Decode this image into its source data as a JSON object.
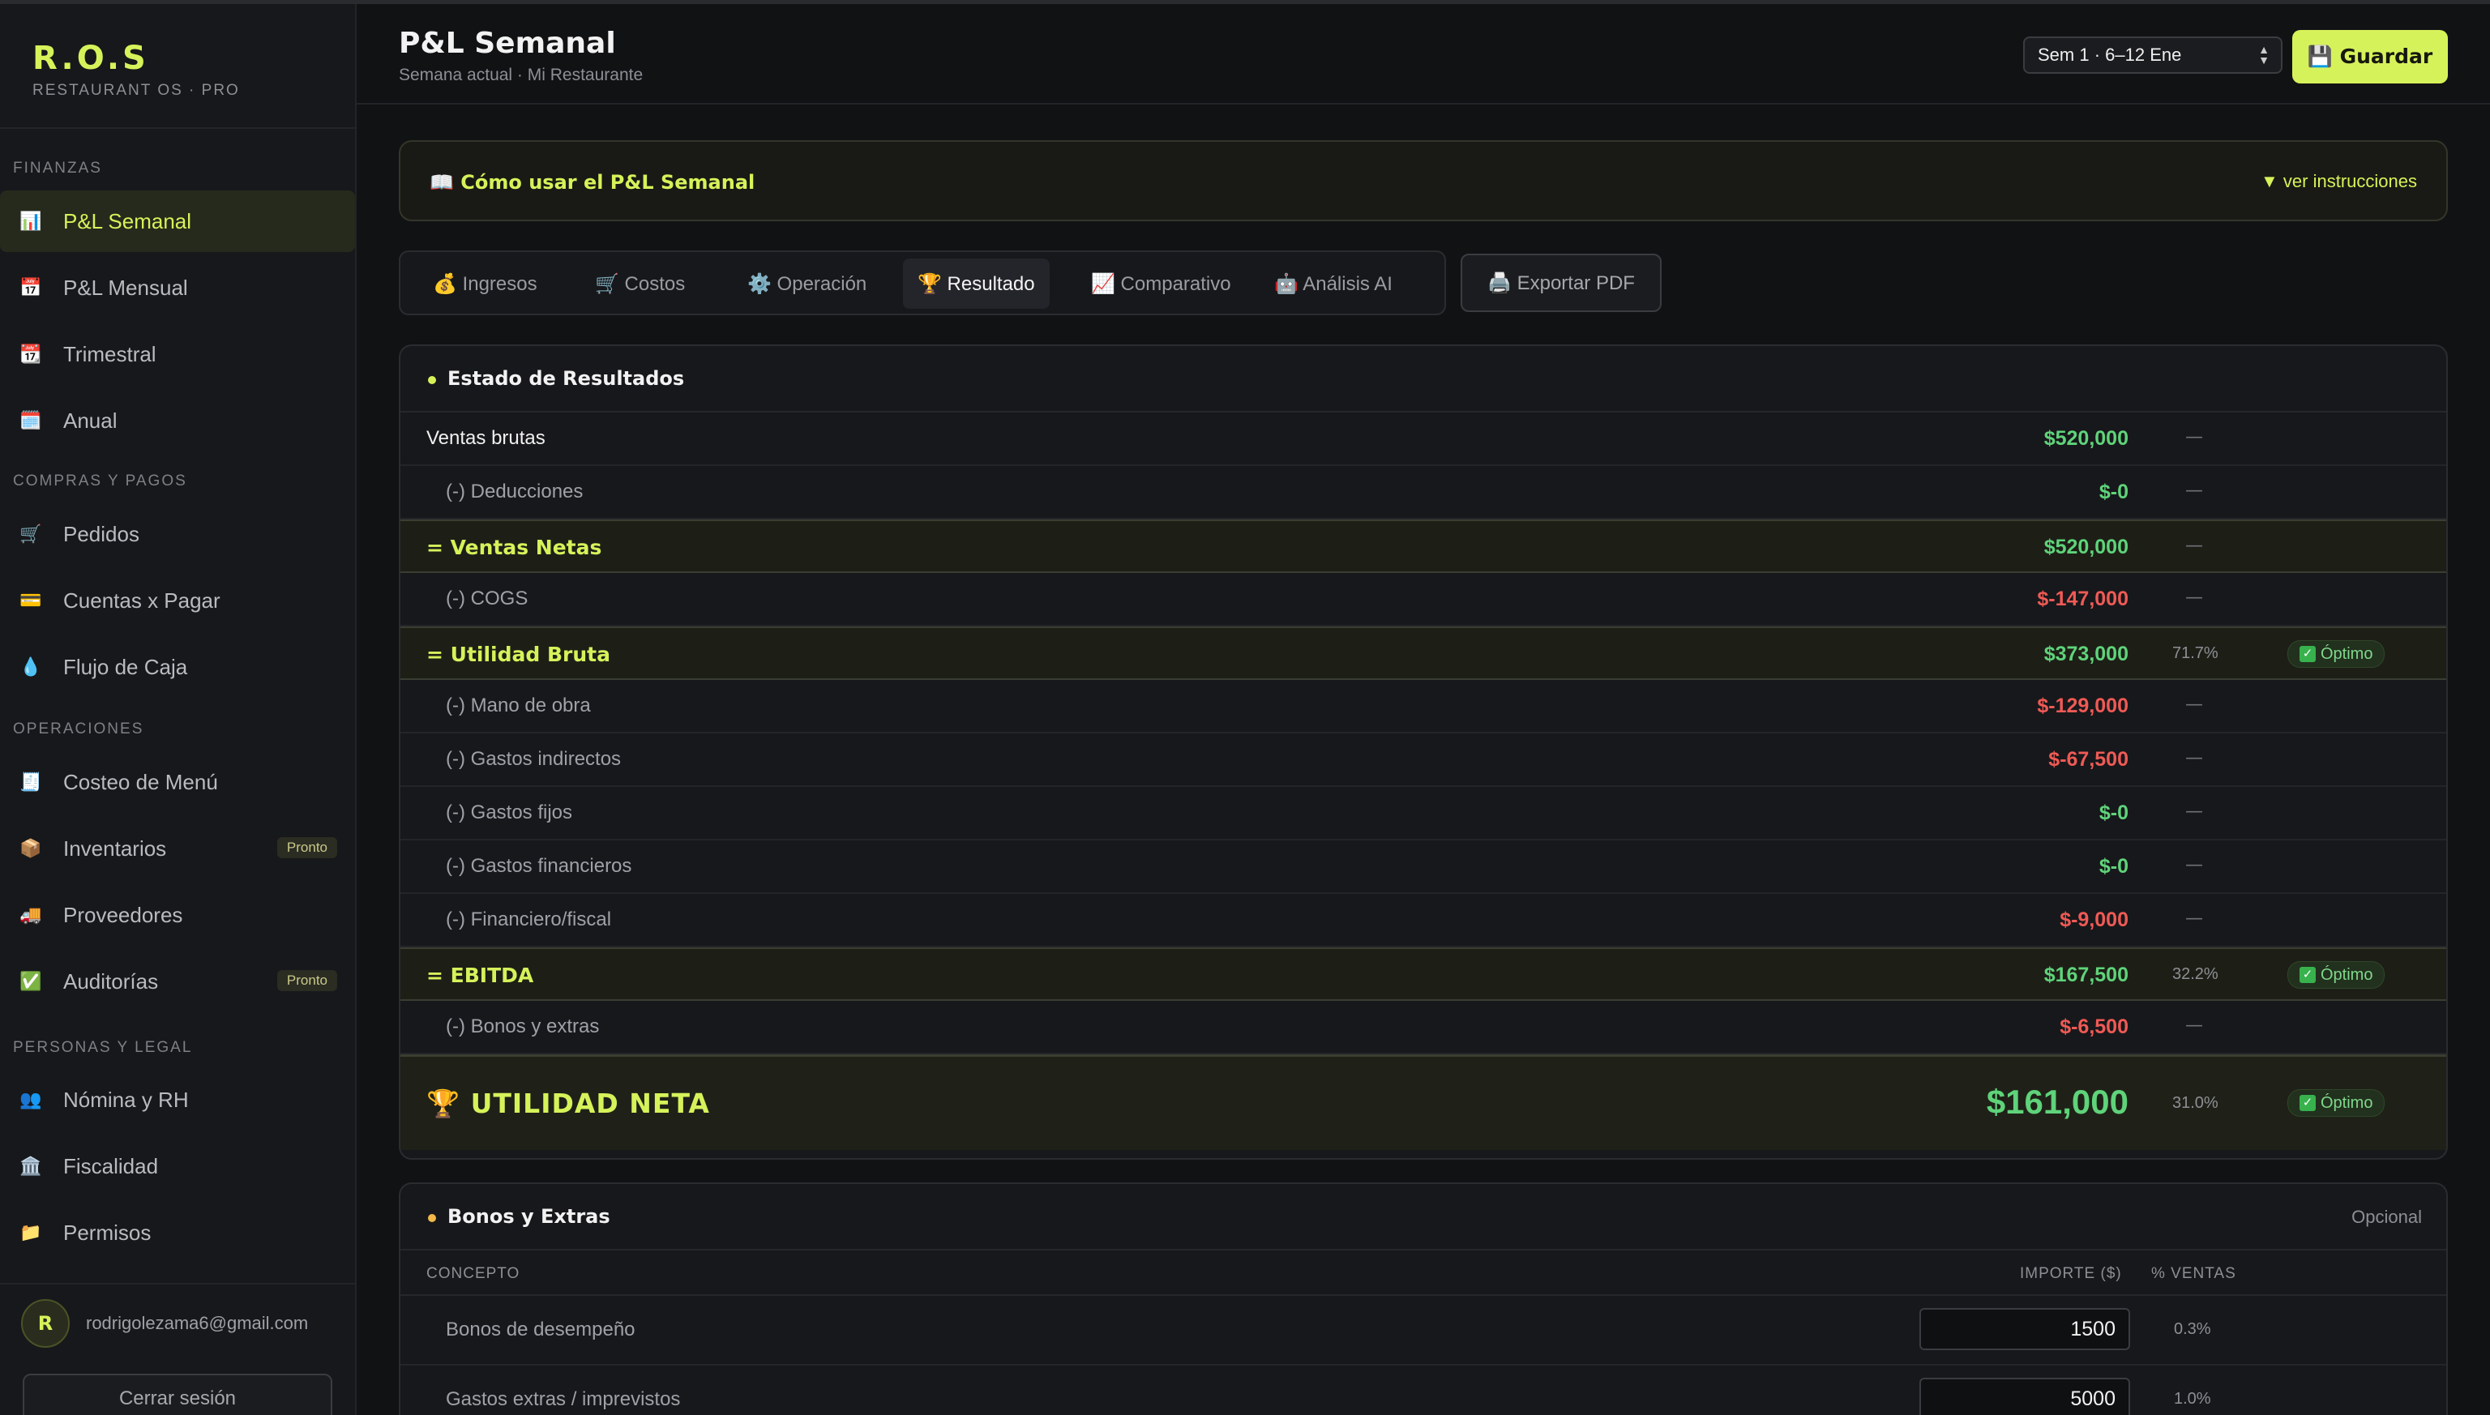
{
  "brand": {
    "logo": "R.O.S",
    "subtitle": "RESTAURANT OS · PRO"
  },
  "sidebar": {
    "sections": [
      {
        "title": "FINANZAS",
        "items": [
          {
            "label": "P&L Semanal",
            "icon": "📊",
            "active": true
          },
          {
            "label": "P&L Mensual",
            "icon": "📅"
          },
          {
            "label": "Trimestral",
            "icon": "📆"
          },
          {
            "label": "Anual",
            "icon": "🗓️"
          }
        ]
      },
      {
        "title": "COMPRAS Y PAGOS",
        "items": [
          {
            "label": "Pedidos",
            "icon": "🛒"
          },
          {
            "label": "Cuentas x Pagar",
            "icon": "💳"
          },
          {
            "label": "Flujo de Caja",
            "icon": "💧"
          }
        ]
      },
      {
        "title": "OPERACIONES",
        "items": [
          {
            "label": "Costeo de Menú",
            "icon": "🧾"
          },
          {
            "label": "Inventarios",
            "icon": "📦",
            "badge": "Pronto"
          },
          {
            "label": "Proveedores",
            "icon": "🚚"
          },
          {
            "label": "Auditorías",
            "icon": "✅",
            "badge": "Pronto"
          }
        ]
      },
      {
        "title": "PERSONAS Y LEGAL",
        "items": [
          {
            "label": "Nómina y RH",
            "icon": "👥"
          },
          {
            "label": "Fiscalidad",
            "icon": "🏛️"
          },
          {
            "label": "Permisos",
            "icon": "📁"
          }
        ]
      }
    ],
    "user": {
      "initial": "R",
      "email": "rodrigolezama6@gmail.com"
    },
    "logout_label": "Cerrar sesión"
  },
  "header": {
    "title": "P&L Semanal",
    "subtitle": "Semana actual · Mi Restaurante",
    "week_selected": "Sem 1 · 6–12 Ene",
    "save_label": "💾 Guardar"
  },
  "help": {
    "title": "📖 Cómo usar el P&L Semanal",
    "toggle": "▼ ver instrucciones"
  },
  "tabs": [
    {
      "label": "💰 Ingresos"
    },
    {
      "label": "🛒 Costos"
    },
    {
      "label": "⚙️ Operación"
    },
    {
      "label": "🏆 Resultado",
      "active": true
    },
    {
      "label": "📈 Comparativo"
    },
    {
      "label": "🤖 Análisis AI"
    }
  ],
  "export_label": "🖨️ Exportar PDF",
  "results": {
    "title": "Estado de Resultados",
    "dot_color": "#d6f25a",
    "rows": [
      {
        "label": "Ventas brutas",
        "amount": "$520,000",
        "sign": "pos",
        "pct": "—",
        "type": "main"
      },
      {
        "label": "(-) Deducciones",
        "amount": "$-0",
        "sign": "pos",
        "pct": "—",
        "type": "sub"
      },
      {
        "label": "= Ventas Netas",
        "amount": "$520,000",
        "sign": "pos",
        "pct": "—",
        "type": "total"
      },
      {
        "label": "(-) COGS",
        "amount": "$-147,000",
        "sign": "neg",
        "pct": "—",
        "type": "sub"
      },
      {
        "label": "= Utilidad Bruta",
        "amount": "$373,000",
        "sign": "pos",
        "pct": "71.7%",
        "type": "total",
        "status": "Óptimo"
      },
      {
        "label": "(-) Mano de obra",
        "amount": "$-129,000",
        "sign": "neg",
        "pct": "—",
        "type": "sub"
      },
      {
        "label": "(-) Gastos indirectos",
        "amount": "$-67,500",
        "sign": "neg",
        "pct": "—",
        "type": "sub"
      },
      {
        "label": "(-) Gastos fijos",
        "amount": "$-0",
        "sign": "pos",
        "pct": "—",
        "type": "sub"
      },
      {
        "label": "(-) Gastos financieros",
        "amount": "$-0",
        "sign": "pos",
        "pct": "—",
        "type": "sub"
      },
      {
        "label": "(-) Financiero/fiscal",
        "amount": "$-9,000",
        "sign": "neg",
        "pct": "—",
        "type": "sub"
      },
      {
        "label": "= EBITDA",
        "amount": "$167,500",
        "sign": "pos",
        "pct": "32.2%",
        "type": "total",
        "status": "Óptimo"
      },
      {
        "label": "(-) Bonos y extras",
        "amount": "$-6,500",
        "sign": "neg",
        "pct": "—",
        "type": "sub"
      }
    ],
    "net": {
      "label": "🏆 UTILIDAD NETA",
      "amount": "$161,000",
      "pct": "31.0%",
      "status": "Óptimo"
    }
  },
  "bonus": {
    "title": "Bonos y Extras",
    "dot_color": "#f0b94a",
    "optional_label": "Opcional",
    "columns": {
      "concept": "CONCEPTO",
      "amount": "IMPORTE ($)",
      "pct": "% VENTAS"
    },
    "rows": [
      {
        "label": "Bonos de desempeño",
        "value": "1500",
        "pct": "0.3%"
      },
      {
        "label": "Gastos extras / imprevistos",
        "value": "5000",
        "pct": "1.0%"
      }
    ]
  },
  "colors": {
    "accent": "#d6f25a",
    "positive": "#5fd37a",
    "negative": "#ef5a55",
    "bg": "#111214"
  }
}
